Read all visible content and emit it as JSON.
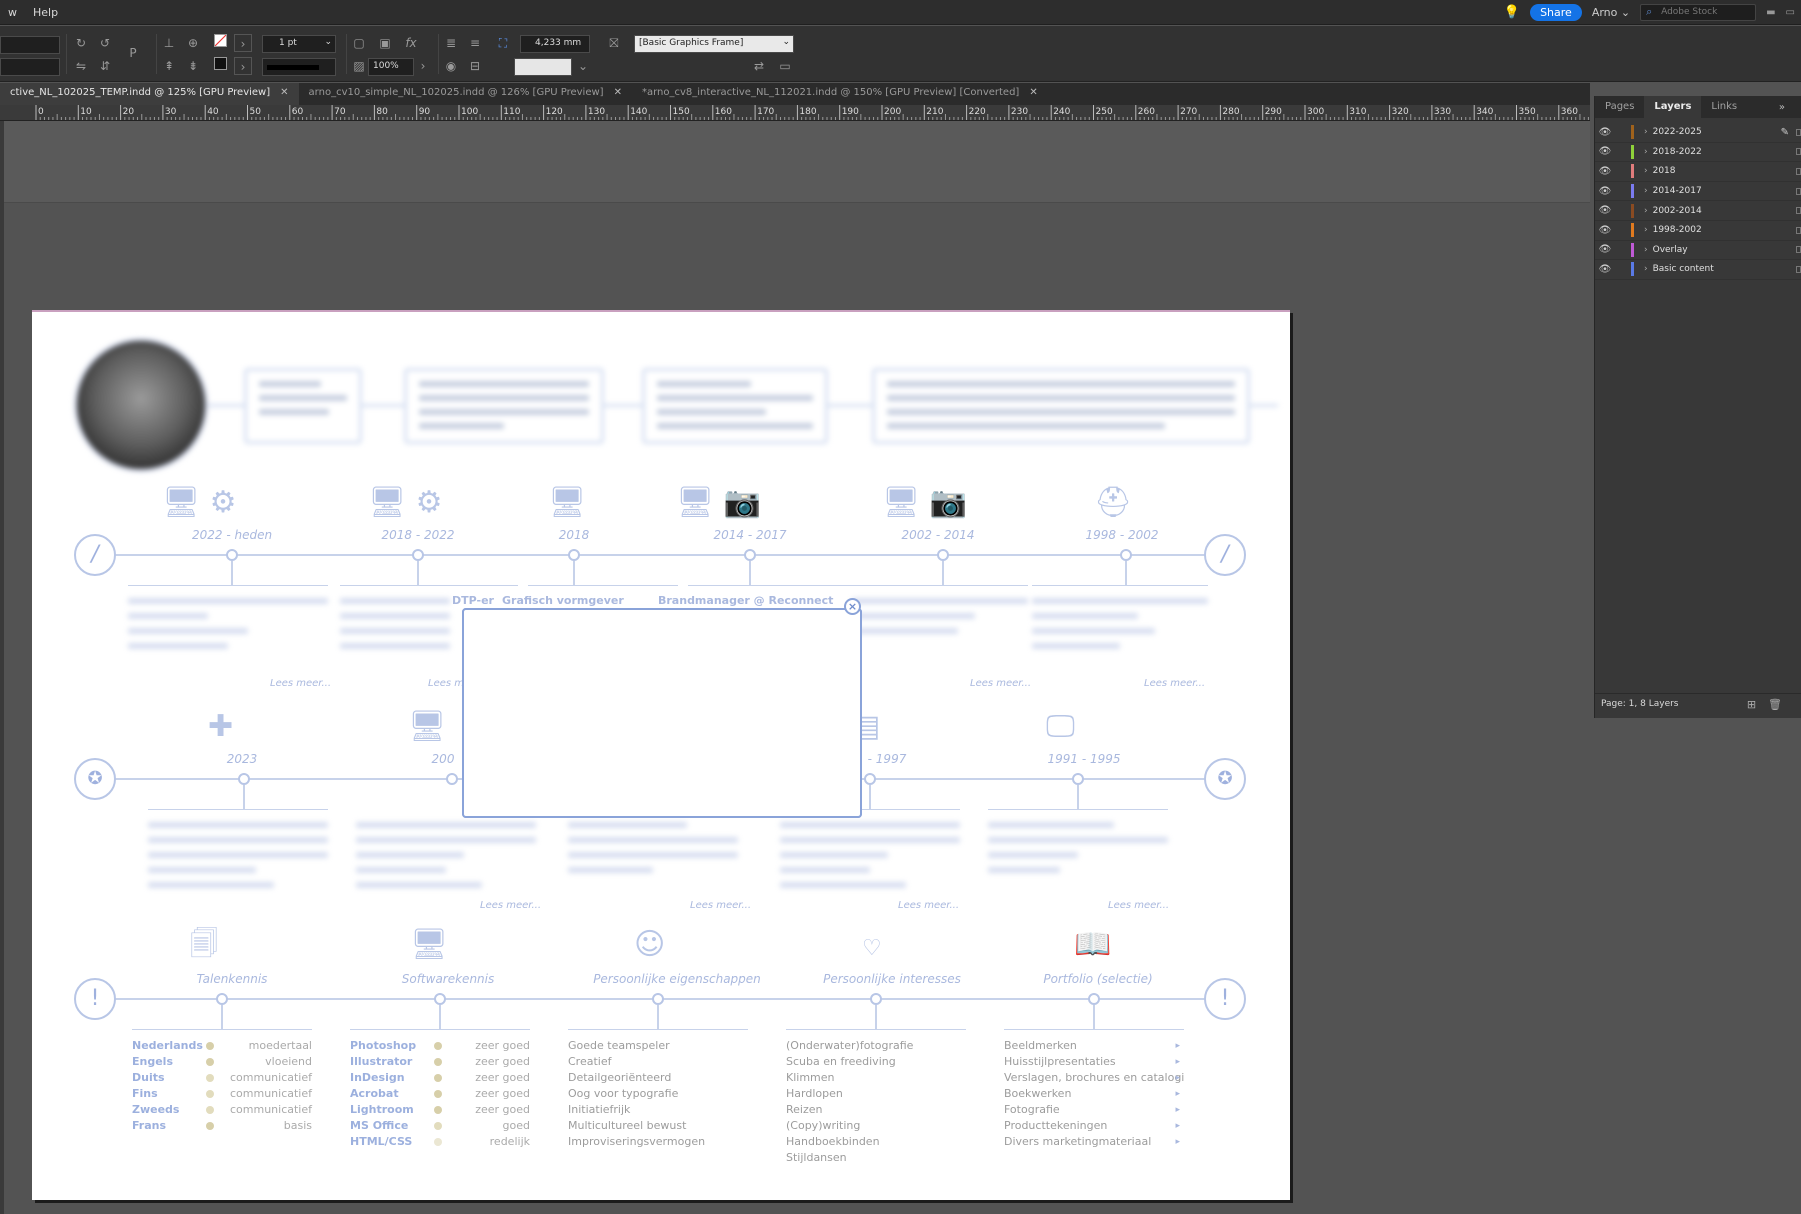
{
  "menubar": {
    "items": [
      "w",
      "Help"
    ],
    "share_label": "Share",
    "user_name": "Arno",
    "stock_placeholder": "Adobe Stock"
  },
  "controlbar": {
    "stroke_weight": "1 pt",
    "opacity": "100%",
    "dimension": "4,233 mm",
    "object_style": "[Basic Graphics Frame]"
  },
  "tabs": [
    {
      "label": "ctive_NL_102025_TEMP.indd @ 125% [GPU Preview]",
      "active": true
    },
    {
      "label": "arno_cv10_simple_NL_102025.indd @ 126% [GPU Preview]",
      "active": false
    },
    {
      "label": "*arno_cv8_interactive_NL_112021.indd @ 150% [GPU Preview] [Converted]",
      "active": false
    }
  ],
  "ruler": {
    "ticks": [
      "0",
      "10",
      "20",
      "30",
      "40",
      "50",
      "60",
      "70",
      "80",
      "90",
      "100",
      "110",
      "120",
      "130",
      "140",
      "150",
      "160",
      "170",
      "180",
      "190",
      "200",
      "210",
      "220",
      "230",
      "240",
      "250",
      "260",
      "270",
      "280",
      "290",
      "300",
      "310",
      "320",
      "330",
      "340",
      "350",
      "360"
    ]
  },
  "panel": {
    "tabs": [
      "Pages",
      "Layers",
      "Links"
    ],
    "active_tab": "Layers",
    "layers": [
      {
        "name": "2022-2025",
        "color": "#a0621c",
        "active": true
      },
      {
        "name": "2018-2022",
        "color": "#8fd13a",
        "active": false
      },
      {
        "name": "2018",
        "color": "#e07c7c",
        "active": false
      },
      {
        "name": "2014-2017",
        "color": "#7b7bef",
        "active": false
      },
      {
        "name": "2002-2014",
        "color": "#8a4b22",
        "active": false
      },
      {
        "name": "1998-2002",
        "color": "#e07a1f",
        "active": false
      },
      {
        "name": "Overlay",
        "color": "#c05ad6",
        "active": false
      },
      {
        "name": "Basic content",
        "color": "#5a7ae6",
        "active": false
      }
    ],
    "footer": "Page: 1, 8 Layers"
  },
  "document": {
    "row1": {
      "periods": [
        "2022 - heden",
        "2018 - 2022",
        "2018",
        "2014 - 2017",
        "2002 - 2014",
        "1998 - 2002"
      ],
      "titles": [
        "DTP-er",
        "Grafisch vormgever",
        "Brandmanager @ Reconnect"
      ]
    },
    "row2": {
      "periods": [
        "2023",
        "200",
        "- 1997",
        "1991 - 1995"
      ]
    },
    "lees_meer": "Lees meer...",
    "lees_meer_short": "Lees m",
    "sections": [
      "Talenkennis",
      "Softwarekennis",
      "Persoonlijke eigenschappen",
      "Persoonlijke interesses",
      "Portfolio (selectie)"
    ],
    "talenkennis": [
      {
        "lang": "Nederlands",
        "level": "moedertaal",
        "color": "#d7cfa9"
      },
      {
        "lang": "Engels",
        "level": "vloeiend",
        "color": "#d7cfa9"
      },
      {
        "lang": "Duits",
        "level": "communicatief",
        "color": "#e2dcbd"
      },
      {
        "lang": "Fins",
        "level": "communicatief",
        "color": "#e2dcbd"
      },
      {
        "lang": "Zweeds",
        "level": "communicatief",
        "color": "#e2dcbd"
      },
      {
        "lang": "Frans",
        "level": "basis",
        "color": "#d7cfa9"
      }
    ],
    "software": [
      {
        "name": "Photoshop",
        "level": "zeer goed",
        "color": "#d7cfa9"
      },
      {
        "name": "Illustrator",
        "level": "zeer goed",
        "color": "#d7cfa9"
      },
      {
        "name": "InDesign",
        "level": "zeer goed",
        "color": "#d7cfa9"
      },
      {
        "name": "Acrobat",
        "level": "zeer goed",
        "color": "#d7cfa9"
      },
      {
        "name": "Lightroom",
        "level": "zeer goed",
        "color": "#d7cfa9"
      },
      {
        "name": "MS Office",
        "level": "goed",
        "color": "#e2dcbd"
      },
      {
        "name": "HTML/CSS",
        "level": "redelijk",
        "color": "#ebe7d3"
      }
    ],
    "eigenschappen": [
      "Goede teamspeler",
      "Creatief",
      "Detailgeoriënteerd",
      "Oog voor typografie",
      "Initiatiefrijk",
      "Multicultureel bewust",
      "Improviseringsvermogen"
    ],
    "interesses": [
      "(Onderwater)fotografie",
      "Scuba en freediving",
      "Klimmen",
      "Hardlopen",
      "Reizen",
      "(Copy)writing",
      "Handboekbinden",
      "Stijldansen"
    ],
    "portfolio": [
      "Beeldmerken",
      "Huisstijlpresentaties",
      "Verslagen, brochures en catalogi",
      "Boekwerken",
      "Fotografie",
      "Producttekeningen",
      "Divers marketingmateriaal"
    ]
  }
}
